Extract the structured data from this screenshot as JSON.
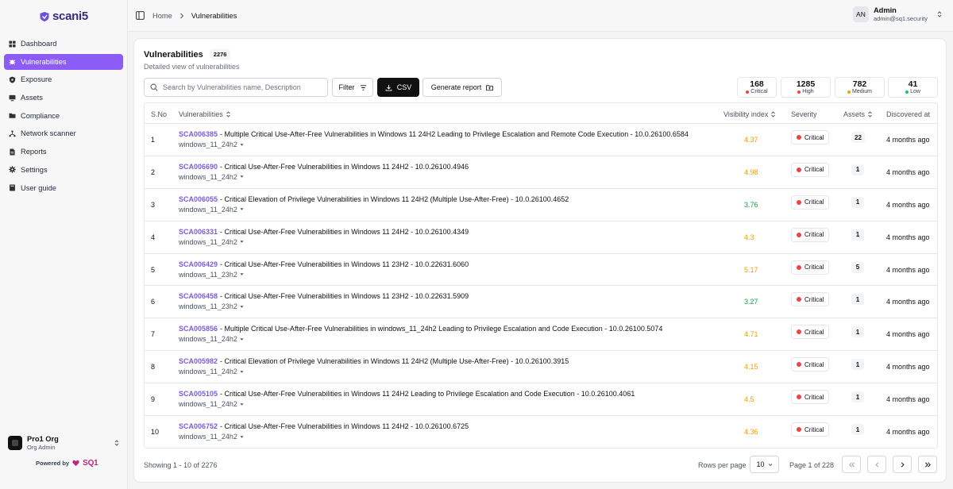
{
  "brand": {
    "name": "scani5"
  },
  "sidebar": {
    "items": [
      {
        "label": "Dashboard",
        "icon": "dashboard-icon",
        "active": false
      },
      {
        "label": "Vulnerabilities",
        "icon": "bug-icon",
        "active": true
      },
      {
        "label": "Exposure",
        "icon": "shield-icon",
        "active": false
      },
      {
        "label": "Assets",
        "icon": "monitor-icon",
        "active": false
      },
      {
        "label": "Compliance",
        "icon": "folder-icon",
        "active": false
      },
      {
        "label": "Network scanner",
        "icon": "network-icon",
        "active": false
      },
      {
        "label": "Reports",
        "icon": "document-icon",
        "active": false
      },
      {
        "label": "Settings",
        "icon": "gear-icon",
        "active": false
      },
      {
        "label": "User guide",
        "icon": "book-icon",
        "active": false
      }
    ],
    "org": {
      "name": "Pro1 Org",
      "role": "Org Admin"
    },
    "powered_by": "Powered by",
    "powered_brand": "SQ1"
  },
  "topbar": {
    "breadcrumb": [
      "Home",
      "Vulnerabilities"
    ],
    "user": {
      "initials": "AN",
      "name": "Admin",
      "email": "admin@sq1.security"
    }
  },
  "main": {
    "title": "Vulnerabilities",
    "count": "2276",
    "subtitle": "Detailed view of vulnerabilities",
    "search_placeholder": "Search by Vulnerabilities name, Description",
    "filter_label": "Filter",
    "csv_label": "CSV",
    "report_label": "Generate report",
    "stats": [
      {
        "value": "168",
        "label": "Critical",
        "color": "#ef4444"
      },
      {
        "value": "1285",
        "label": "High",
        "color": "#ef4444"
      },
      {
        "value": "782",
        "label": "Medium",
        "color": "#f59e0b"
      },
      {
        "value": "41",
        "label": "Low",
        "color": "#22c55e"
      }
    ],
    "columns": {
      "sno": "S.No",
      "vulnerabilities": "Vulnerabilities",
      "visibility": "Visibility index",
      "severity": "Severity",
      "assets": "Assets",
      "discovered": "Discovered at"
    },
    "rows": [
      {
        "sno": "1",
        "id": "SCA006385",
        "desc": "- Multiple Critical Use-After-Free Vulnerabilities in Windows 11 24H2 Leading to Privilege Escalation and Remote Code Execution - 10.0.26100.6584",
        "tag": "windows_11_24h2",
        "vis": "4.37",
        "vis_color": "#f59e0b",
        "severity": "Critical",
        "assets": "22",
        "discovered": "4 months ago"
      },
      {
        "sno": "2",
        "id": "SCA006690",
        "desc": "- Critical Use-After-Free Vulnerabilities in Windows 11 24H2 - 10.0.26100.4946",
        "tag": "windows_11_24h2",
        "vis": "4.98",
        "vis_color": "#f59e0b",
        "severity": "Critical",
        "assets": "1",
        "discovered": "4 months ago"
      },
      {
        "sno": "3",
        "id": "SCA006055",
        "desc": "- Critical Elevation of Privilege Vulnerabilities in Windows 11 24H2 (Multiple Use-After-Free) - 10.0.26100.4652",
        "tag": "windows_11_24h2",
        "vis": "3.76",
        "vis_color": "#16a34a",
        "severity": "Critical",
        "assets": "1",
        "discovered": "4 months ago"
      },
      {
        "sno": "4",
        "id": "SCA006331",
        "desc": "- Critical Use-After-Free Vulnerabilities in Windows 11 24H2 - 10.0.26100.4349",
        "tag": "windows_11_24h2",
        "vis": "4.3",
        "vis_color": "#f59e0b",
        "severity": "Critical",
        "assets": "1",
        "discovered": "4 months ago"
      },
      {
        "sno": "5",
        "id": "SCA006429",
        "desc": "- Critical Use-After-Free Vulnerabilities in Windows 11 23H2 - 10.0.22631.6060",
        "tag": "windows_11_23h2",
        "vis": "5.17",
        "vis_color": "#f59e0b",
        "severity": "Critical",
        "assets": "5",
        "discovered": "4 months ago"
      },
      {
        "sno": "6",
        "id": "SCA006458",
        "desc": "- Critical Use-After-Free Vulnerabilities in Windows 11 23H2 - 10.0.22631.5909",
        "tag": "windows_11_23h2",
        "vis": "3.27",
        "vis_color": "#16a34a",
        "severity": "Critical",
        "assets": "1",
        "discovered": "4 months ago"
      },
      {
        "sno": "7",
        "id": "SCA005856",
        "desc": "- Multiple Critical Use-After-Free Vulnerabilities in windows_11_24h2 Leading to Privilege Escalation and Code Execution - 10.0.26100.5074",
        "tag": "windows_11_24h2",
        "vis": "4.71",
        "vis_color": "#f59e0b",
        "severity": "Critical",
        "assets": "1",
        "discovered": "4 months ago"
      },
      {
        "sno": "8",
        "id": "SCA005982",
        "desc": "- Critical Elevation of Privilege Vulnerabilities in Windows 11 24H2 (Multiple Use-After-Free) - 10.0.26100.3915",
        "tag": "windows_11_24h2",
        "vis": "4.15",
        "vis_color": "#f59e0b",
        "severity": "Critical",
        "assets": "1",
        "discovered": "4 months ago"
      },
      {
        "sno": "9",
        "id": "SCA005105",
        "desc": "- Critical Use-After-Free Vulnerabilities in Windows 11 24H2 Leading to Privilege Escalation and Code Execution - 10.0.26100.4061",
        "tag": "windows_11_24h2",
        "vis": "4.5",
        "vis_color": "#f59e0b",
        "severity": "Critical",
        "assets": "1",
        "discovered": "4 months ago"
      },
      {
        "sno": "10",
        "id": "SCA006752",
        "desc": "- Critical Use-After-Free Vulnerabilities in Windows 11 24H2 - 10.0.26100.6725",
        "tag": "windows_11_24h2",
        "vis": "4.36",
        "vis_color": "#f59e0b",
        "severity": "Critical",
        "assets": "1",
        "discovered": "4 months ago"
      }
    ],
    "footer": {
      "showing": "Showing 1 - 10 of 2276",
      "rows_per_page_label": "Rows per page",
      "rows_per_page_value": "10",
      "page_info": "Page 1 of 228"
    }
  }
}
